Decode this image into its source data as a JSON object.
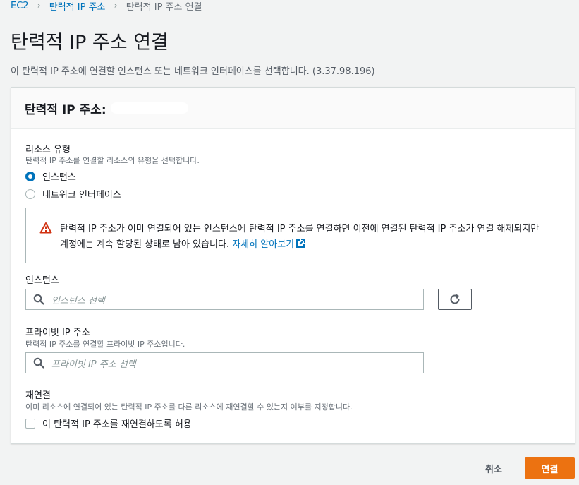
{
  "breadcrumb": {
    "root": "EC2",
    "parent": "탄력적 IP 주소",
    "current": "탄력적 IP 주소 연결"
  },
  "page": {
    "title": "탄력적 IP 주소 연결",
    "description": "이 탄력적 IP 주소에 연결할 인스턴스 또는 네트워크 인터페이스를 선택합니다. (3.37.98.196)"
  },
  "panel": {
    "title": "탄력적 IP 주소:"
  },
  "resource_type": {
    "label": "리소스 유형",
    "description": "탄력적 IP 주소를 연결할 리소스의 유형을 선택합니다.",
    "options": [
      "인스턴스",
      "네트워크 인터페이스"
    ],
    "selected": "인스턴스"
  },
  "warning": {
    "text": "탄력적 IP 주소가 이미 연결되어 있는 인스턴스에 탄력적 IP 주소를 연결하면 이전에 연결된 탄력적 IP 주소가 연결 해제되지만 계정에는 계속 할당된 상태로 남아 있습니다.",
    "link": "자세히 알아보기",
    "icon": "warning-icon",
    "color": "#d13212"
  },
  "instance": {
    "label": "인스턴스",
    "placeholder": "인스턴스 선택"
  },
  "private_ip": {
    "label": "프라이빗 IP 주소",
    "description": "탄력적 IP 주소를 연결할 프라이빗 IP 주소입니다.",
    "placeholder": "프라이빗 IP 주소 선택"
  },
  "reassociate": {
    "label": "재연결",
    "description": "이미 리소스에 연결되어 있는 탄력적 IP 주소를 다른 리소스에 재연결할 수 있는지 여부를 지정합니다.",
    "checkbox_label": "이 탄력적 IP 주소를 재연결하도록 허용",
    "checked": false
  },
  "actions": {
    "cancel": "취소",
    "submit": "연결"
  },
  "colors": {
    "accent": "#0073bb",
    "primary_button": "#ec7211"
  }
}
